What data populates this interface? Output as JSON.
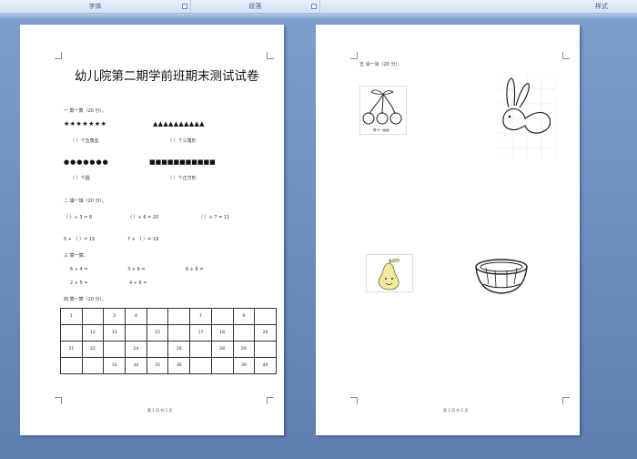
{
  "ribbon": {
    "groups": [
      {
        "label": "字体"
      },
      {
        "label": "段落"
      },
      {
        "label": "样式"
      }
    ]
  },
  "page1": {
    "title": "幼儿院第二期学前班期末测试试卷",
    "s1_heading": "一  数一数（20 分）。",
    "stars": "★★★★★★★",
    "triangles": "▲▲▲▲▲▲▲▲▲▲",
    "stars_q": "（    ）个五角星",
    "triangles_q": "（    ）个三角形",
    "circles": "●●●●●●●",
    "squares": "■■■■■■■■■■■",
    "circles_q": "（    ）个圆",
    "squares_q": "（    ）个正方形",
    "s2_heading": "二  填一填（20 分）。",
    "fill_row1": [
      "（    ）+ 3 = 8",
      "（    ）+ 6 = 20",
      "（    ）+ 7 = 11"
    ],
    "fill_row2": [
      "5 + （    ）= 15",
      "7 + （    ）= 19"
    ],
    "s3_heading": "三  算一算。",
    "calc_row1": [
      "6 + 4 =",
      "3 + 9 =",
      "6 + 8 ="
    ],
    "calc_row2": [
      "2 + 5 =",
      "4 + 6 ="
    ],
    "s4_heading": "四  算一算（20 分）。",
    "table": [
      [
        "1",
        "",
        "3",
        "4",
        "",
        "",
        "7",
        "",
        "9",
        ""
      ],
      [
        "",
        "12",
        "13",
        "",
        "15",
        "",
        "17",
        "18",
        "",
        "20"
      ],
      [
        "21",
        "22",
        "",
        "24",
        "",
        "26",
        "",
        "28",
        "29",
        ""
      ],
      [
        "",
        "",
        "33",
        "34",
        "35",
        "36",
        "",
        "",
        "39",
        "40"
      ]
    ],
    "footer": "第 1 页 共 1 页"
  },
  "page2": {
    "s5_heading": "五  涂一涂（20 分）。",
    "caption_cherry": "帮卡一画画",
    "footer": "第 2 页 共 2 页"
  },
  "colors": {
    "background": "#6f90c1",
    "ribbon": "#d3e1f3"
  }
}
